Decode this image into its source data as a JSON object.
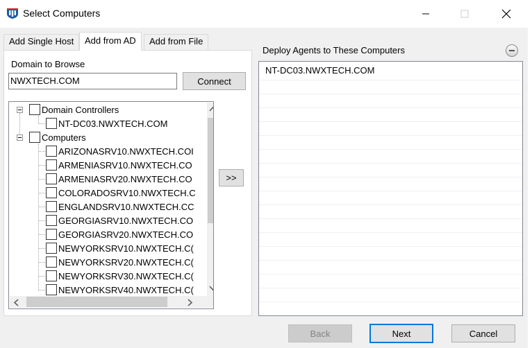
{
  "window": {
    "title": "Select Computers"
  },
  "tabs": [
    {
      "label": "Add Single Host",
      "active": false
    },
    {
      "label": "Add from AD",
      "active": true
    },
    {
      "label": "Add from File",
      "active": false
    }
  ],
  "ad_panel": {
    "domain_label": "Domain to Browse",
    "domain_value": "NWXTECH.COM",
    "connect_label": "Connect"
  },
  "tree": {
    "groups": [
      {
        "label": "Domain Controllers",
        "checked": false,
        "children": [
          "NT-DC03.NWXTECH.COM"
        ]
      },
      {
        "label": "Computers",
        "checked": false,
        "children": [
          "ARIZONASRV10.NWXTECH.COI",
          "ARMENIASRV10.NWXTECH.CO",
          "ARMENIASRV20.NWXTECH.CO",
          "COLORADOSRV10.NWXTECH.C",
          "ENGLANDSRV10.NWXTECH.CC",
          "GEORGIASRV10.NWXTECH.CO",
          "GEORGIASRV20.NWXTECH.CO",
          "NEWYORKSRV10.NWXTECH.C(",
          "NEWYORKSRV20.NWXTECH.C(",
          "NEWYORKSRV30.NWXTECH.C(",
          "NEWYORKSRV40.NWXTECH.C("
        ]
      }
    ]
  },
  "add_button_label": ">>",
  "deploy": {
    "title": "Deploy Agents to These Computers",
    "items": [
      "NT-DC03.NWXTECH.COM"
    ]
  },
  "footer": {
    "back_label": "Back",
    "next_label": "Next",
    "cancel_label": "Cancel"
  },
  "icons": {
    "app": "app-logo-icon",
    "minimize": "minimize-icon",
    "maximize": "maximize-icon",
    "close": "close-icon"
  },
  "colors": {
    "accent": "#0078d7",
    "logo": "#1a5aa6"
  }
}
